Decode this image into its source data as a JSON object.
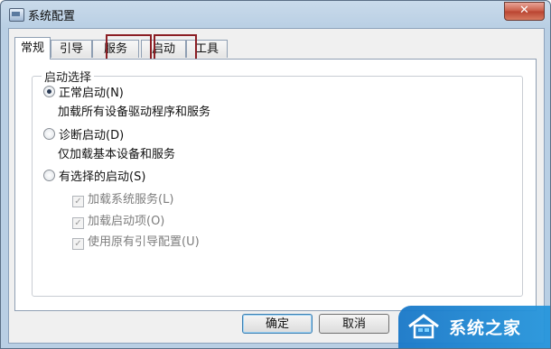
{
  "window": {
    "title": "系统配置",
    "close_label": "✕"
  },
  "tabs": [
    {
      "label": "常规",
      "active": true
    },
    {
      "label": "引导",
      "active": false
    },
    {
      "label": "服务",
      "active": false,
      "highlighted": true
    },
    {
      "label": "启动",
      "active": false,
      "highlighted": true
    },
    {
      "label": "工具",
      "active": false
    }
  ],
  "startup_group": {
    "title": "启动选择",
    "options": [
      {
        "label": "正常启动(N)",
        "description": "加载所有设备驱动程序和服务",
        "selected": true
      },
      {
        "label": "诊断启动(D)",
        "description": "仅加载基本设备和服务",
        "selected": false
      },
      {
        "label": "有选择的启动(S)",
        "selected": false
      }
    ],
    "selective_items": [
      {
        "label": "加载系统服务(L)",
        "checked": true,
        "enabled": false
      },
      {
        "label": "加载启动项(O)",
        "checked": true,
        "enabled": false
      },
      {
        "label": "使用原有引导配置(U)",
        "checked": true,
        "enabled": false
      }
    ]
  },
  "buttons": {
    "ok": "确定",
    "cancel": "取消"
  },
  "watermark": {
    "text": "系统之家"
  },
  "colors": {
    "highlight_border": "#8b1e24",
    "title_bar": "#b9cfe4",
    "watermark": "#1e86d2"
  }
}
